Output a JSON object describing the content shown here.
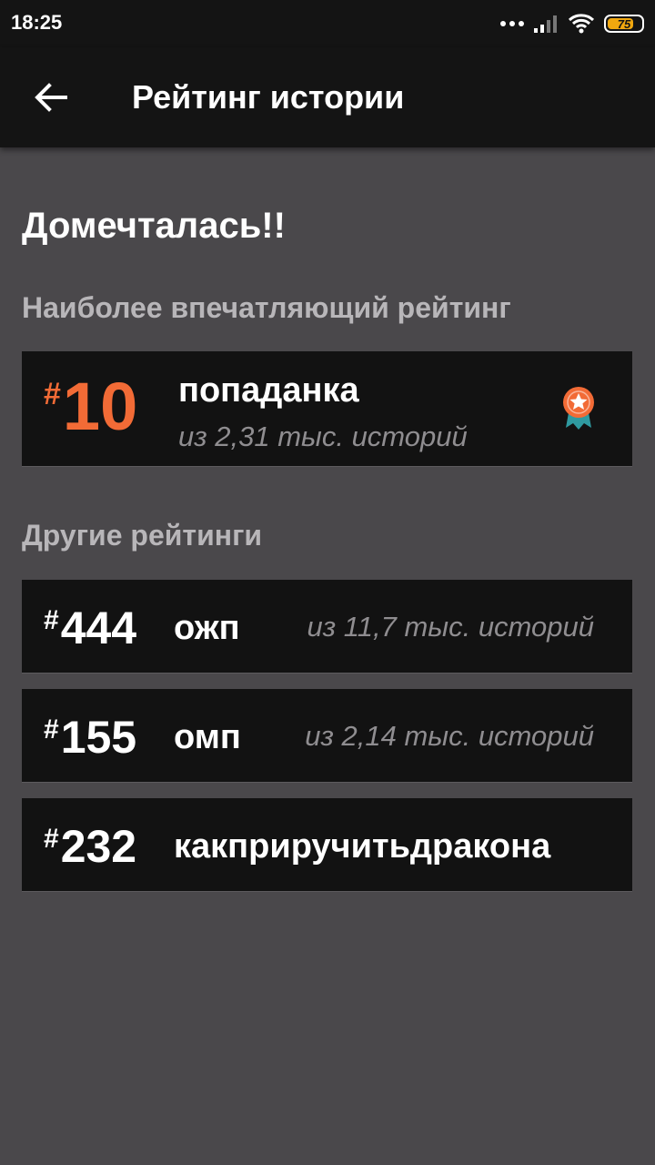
{
  "status_bar": {
    "time": "18:25",
    "battery": "75"
  },
  "header": {
    "back_icon": "arrow-left-icon",
    "title": "Рейтинг истории"
  },
  "story": {
    "title": "Домечталась!!"
  },
  "featured": {
    "section_label": "Наиболее впечатляющий рейтинг",
    "hash": "#",
    "rank": "10",
    "tag": "попаданка",
    "total": "из 2,31 тыс. историй",
    "icon": "medal-icon",
    "accent_color": "#f26b36"
  },
  "others": {
    "section_label": "Другие рейтинги",
    "items": [
      {
        "hash": "#",
        "rank": "444",
        "tag": "ожп",
        "total": "из 11,7 тыс. историй"
      },
      {
        "hash": "#",
        "rank": "155",
        "tag": "омп",
        "total": "из 2,14 тыс. историй"
      },
      {
        "hash": "#",
        "rank": "232",
        "tag": "какприручитьдракона"
      }
    ]
  }
}
